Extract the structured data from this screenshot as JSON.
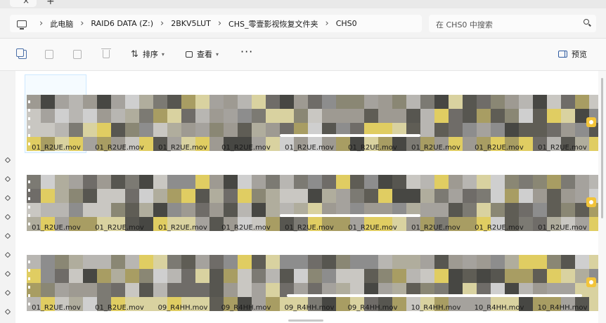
{
  "address": {
    "crumbs": [
      "此电脑",
      "RAID6 DATA (Z:)",
      "2BKV5LUT",
      "CHS_零壹影视恢复文件夹",
      "CHS0"
    ]
  },
  "search": {
    "placeholder": "在 CHS0 中搜索"
  },
  "toolbar": {
    "sort_label": "排序",
    "view_label": "查看",
    "more_label": "···",
    "preview_label": "预览"
  },
  "rows": [
    {
      "labels": [
        "01_R2UE.mov",
        "01_R2UE.mov",
        "01_R2UE.mov",
        "01_R2UE.mov",
        "01_R2UE.mov",
        "01_R2UE.mov",
        "01_R2UE.mov",
        "01_R2UE.mov",
        "01_R2UE.mov"
      ]
    },
    {
      "labels": [
        "01_R2UE.mov",
        "01_R2UE.mov",
        "01_R2UE.mov",
        "01_R2UE.mov",
        "01_R2UE.mov",
        "01_R2UE.mov",
        "01_R2UE.mov",
        "01_R2UE.mov",
        "01_R2UE.mov"
      ]
    },
    {
      "labels": [
        "01_R2UE.mov",
        "01_R2UE.mov",
        "09_R4HH.mov",
        "09_R4HH.mov",
        "09_R4HH.mov",
        "09_R4HH.mov",
        "10_R4HH.mov",
        "10_R4HH.mov",
        "10_R4HH.mov"
      ]
    }
  ],
  "colors": {
    "accent": "#f2c43a",
    "selection": "#cde8ff"
  }
}
